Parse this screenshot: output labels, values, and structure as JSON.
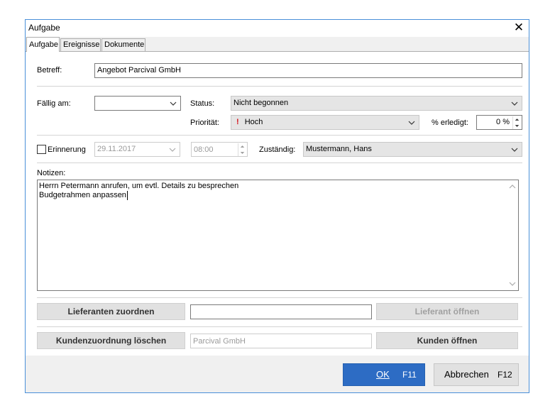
{
  "window": {
    "title": "Aufgabe",
    "close_symbol": "✕"
  },
  "tabs": [
    {
      "label": "Aufgabe",
      "active": true
    },
    {
      "label": "Ereignisse",
      "active": false
    },
    {
      "label": "Dokumente",
      "active": false
    }
  ],
  "form": {
    "subject_label": "Betreff:",
    "subject_value": "Angebot Parcival GmbH",
    "due_label": "Fällig am:",
    "due_value": "",
    "status_label": "Status:",
    "status_value": "Nicht begonnen",
    "priority_label": "Priorität:",
    "priority_mark": "!",
    "priority_value": "Hoch",
    "done_label": "% erledigt:",
    "done_value": "0 %",
    "reminder_label": "Erinnerung",
    "reminder_checked": false,
    "reminder_date": "29.11.2017",
    "reminder_time": "08:00",
    "assigned_label": "Zuständig:",
    "assigned_value": "Mustermann, Hans",
    "notes_label": "Notizen:",
    "notes_line1": "Herrn Petermann anrufen, um evtl. Details zu besprechen",
    "notes_line2": "Budgetrahmen anpassen"
  },
  "supplier": {
    "assign_button": "Lieferanten zuordnen",
    "field_value": "",
    "open_button": "Lieferant öffnen"
  },
  "customer": {
    "remove_button": "Kundenzuordnung löschen",
    "field_value": "Parcival GmbH",
    "open_button": "Kunden öffnen"
  },
  "footer": {
    "ok_label": "OK",
    "ok_key": "F11",
    "cancel_label": "Abbrechen",
    "cancel_key": "F12"
  },
  "colors": {
    "accent": "#2d6cc4",
    "priority_mark": "#d4111b",
    "window_border": "#4a90d9"
  },
  "icons": {
    "close": "close-icon",
    "dropdown": "chevron-down-icon",
    "spin_up": "spin-up-icon",
    "spin_down": "spin-down-icon",
    "scroll_up": "scroll-up-icon",
    "scroll_down": "scroll-down-icon"
  }
}
